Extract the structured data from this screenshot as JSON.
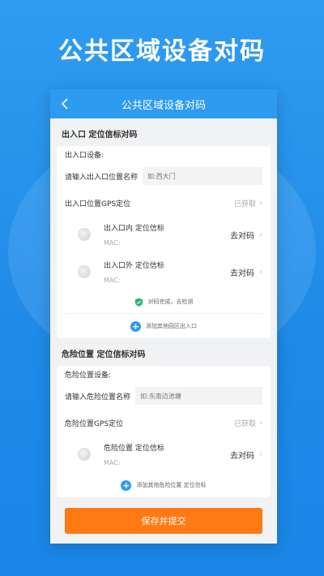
{
  "hero": {
    "title": "公共区域设备对码"
  },
  "nav": {
    "title": "公共区域设备对码"
  },
  "entrance": {
    "section_title": "出入口 定位信标对码",
    "device_label": "出入口设备:",
    "input_label": "请输入出入口位置名称",
    "input_placeholder": "如:西大门",
    "gps_label": "出入口位置GPS定位",
    "gps_status": "已获取",
    "beacons": [
      {
        "name": "出入口内 定位信标",
        "mac": "MAC:",
        "action": "去对码"
      },
      {
        "name": "出入口外 定位信标",
        "mac": "MAC:",
        "action": "去对码"
      }
    ],
    "done_text": "对码完成，去检测",
    "add_text": "添加其他园区出入口"
  },
  "danger": {
    "section_title": "危险位置 定位信标对码",
    "device_label": "危险位置设备:",
    "input_label": "请输入危险位置名称",
    "input_placeholder": "如:东南边池塘",
    "gps_label": "危险位置GPS定位",
    "gps_status": "已获取",
    "beacons": [
      {
        "name": "危险位置 定位信标",
        "mac": "MAC:",
        "action": "去对码"
      }
    ],
    "add_text": "添加其他危险位置 定位信标"
  },
  "footer": {
    "save_label": "保存并提交"
  },
  "colors": {
    "primary": "#2d9bf0",
    "accent": "#ff7a14",
    "success": "#2bb673"
  }
}
